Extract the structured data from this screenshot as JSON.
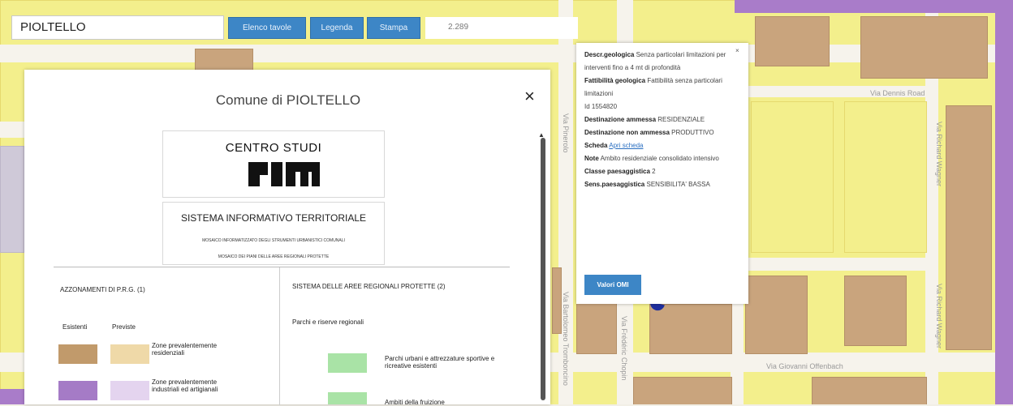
{
  "search": {
    "value": "PIOLTELLO"
  },
  "toolbar": {
    "elenco_label": "Elenco tavole",
    "legenda_label": "Legenda",
    "stampa_label": "Stampa",
    "scale_value": "2.289"
  },
  "legend": {
    "title": "Comune di PIOLTELLO",
    "close_label": "×",
    "logo_text": "CENTRO STUDI",
    "logo_mark": "PIM",
    "system_title": "SISTEMA INFORMATIVO TERRITORIALE",
    "system_sub1": "MOSAICO INFORMATIZZATO DEGLI STRUMENTI URBANISTICI COMUNALI",
    "system_sub2": "MOSAICO DEI PIANI DELLE AREE REGIONALI PROTETTE",
    "left_heading": "AZZONAMENTI DI P.R.G.   (1)",
    "existing_label": "Esistenti",
    "planned_label": "Previste",
    "item1_label": "Zone prevalentemente residenziali",
    "item2_label": "Zone prevalentemente industriali ed artigianali",
    "right_heading": "SISTEMA DELLE AREE REGIONALI PROTETTE (2)",
    "parks_label": "Parchi e riserve regionali",
    "park_item1": "Parchi urbani e attrezzature sportive e ricreative esistenti",
    "park_item2": "Ambiti della fruizione",
    "colors": {
      "res_existing": "#c19a6b",
      "res_planned": "#efd9a8",
      "ind_existing": "#a57bc6",
      "ind_planned": "#e4d4ef",
      "park_green": "#a9e3a6"
    }
  },
  "popup": {
    "close_label": "×",
    "desc_geo_key": "Descr.geologica",
    "desc_geo_val": "Senza particolari limitazioni per interventi fino a 4 mt di profondità",
    "fatt_key": "Fattibilità geologica",
    "fatt_val": "Fattibilità senza particolari limitazioni",
    "id_val": "Id 1554820",
    "dest_key": "Destinazione ammessa",
    "dest_val": "RESIDENZIALE",
    "dest_non_key": "Destinazione non ammessa",
    "dest_non_val": "PRODUTTIVO",
    "scheda_key": "Scheda",
    "scheda_link": "Apri scheda",
    "note_key": "Note",
    "note_val": "Ambito residenziale consolidato intensivo",
    "classe_key": "Classe paesaggistica",
    "classe_val": "2",
    "sens_key": "Sens.paesaggistica",
    "sens_val": "SENSIBILITA' BASSA",
    "button_label": "Valori OMI"
  },
  "map": {
    "road1": "Via Dennis Road",
    "road2": "Via Richard Wagner",
    "road3": "Via Giovanni Offenbach",
    "road4": "Via Richard Wagner",
    "road5": "Via Frédéric Chopin",
    "road6": "Via Bartolomeo Tromboncino",
    "road7": "Via Pinerolo"
  }
}
